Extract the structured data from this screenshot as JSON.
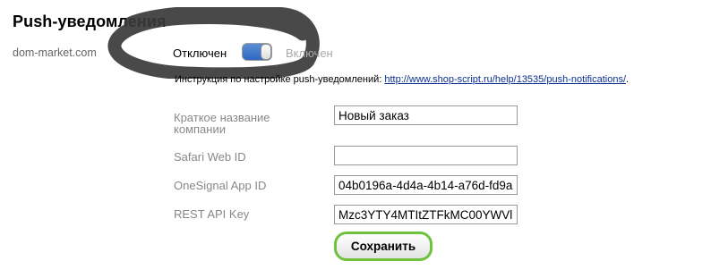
{
  "header": {
    "title": "Push-уведомления"
  },
  "site": {
    "name": "dom-market.com"
  },
  "toggle": {
    "off_label": "Отключен",
    "on_label": "Включен",
    "accent": "#2f67c0"
  },
  "instructions": {
    "text": "Инструкция по настройке push-уведомлений: ",
    "link_text": "http://www.shop-script.ru/help/13535/push-notifications/",
    "suffix": "."
  },
  "form": {
    "fields": [
      {
        "label": "Краткое название компании",
        "value": "Новый заказ"
      },
      {
        "label": "Safari Web ID",
        "value": ""
      },
      {
        "label": "OneSignal App ID",
        "value": "04b0196a-4d4a-4b14-a76d-fd9a"
      },
      {
        "label": "REST API Key",
        "value": "Mzc3YTY4MTItZTFkMC00YWVl"
      }
    ],
    "save_label": "Сохранить",
    "save_border_color": "#6ec23e"
  }
}
